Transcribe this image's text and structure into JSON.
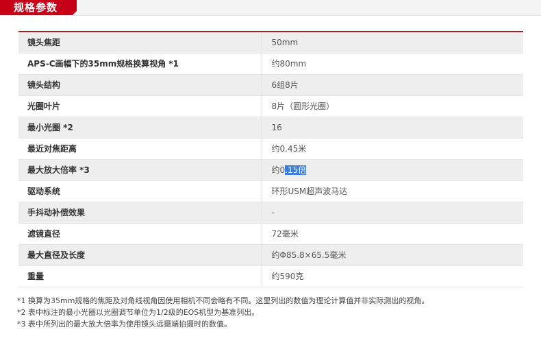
{
  "section": {
    "title": "规格参数"
  },
  "specs": [
    {
      "label": "镜头焦距",
      "value": "50mm"
    },
    {
      "label": "APS-C画幅下的35mm规格换算视角 *1",
      "value": "约80mm"
    },
    {
      "label": "镜头结构",
      "value": "6组8片"
    },
    {
      "label": "光圈叶片",
      "value": "8片（圆形光圈）"
    },
    {
      "label": "最小光圈 *2",
      "value": "16"
    },
    {
      "label": "最近对焦距离",
      "value": "约0.45米"
    },
    {
      "label": "最大放大倍率 *3",
      "value_prefix": "约0",
      "value_selected": ".15倍"
    },
    {
      "label": "驱动系统",
      "value": "环形USM超声波马达"
    },
    {
      "label": "手抖动补偿效果",
      "value": "-"
    },
    {
      "label": "滤镜直径",
      "value": "72毫米"
    },
    {
      "label": "最大直径及长度",
      "value": "约Φ85.8×65.5毫米"
    },
    {
      "label": "重量",
      "value": "约590克"
    }
  ],
  "notes": [
    "*1 换算为35mm规格的焦距及对角线视角因使用相机不同会略有不同。这里列出的数值为理论计算值并非实际测出的视角。",
    "*2 表中标注的最小光圈以光圈调节单位为1/2级的EOS机型为基准列出。",
    "*3 表中所列出的最大放大倍率为使用镜头远摄端拍摄时的数值。"
  ],
  "colors": {
    "accent": "#c70018",
    "table_top_border": "#a01d26",
    "alt_row": "#eeeeee",
    "selection": "#3b7ddf"
  }
}
